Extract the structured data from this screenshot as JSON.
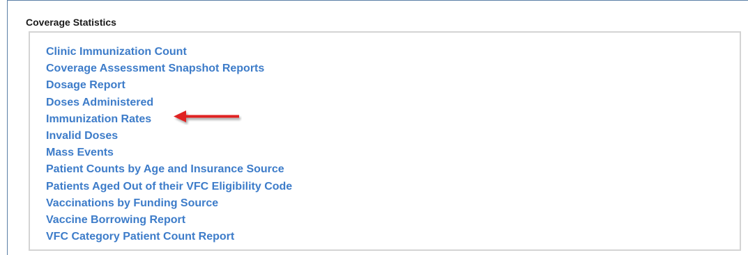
{
  "section": {
    "title": "Coverage Statistics"
  },
  "links": [
    {
      "label": "Clinic Immunization Count"
    },
    {
      "label": "Coverage Assessment Snapshot Reports"
    },
    {
      "label": "Dosage Report"
    },
    {
      "label": "Doses Administered"
    },
    {
      "label": "Immunization Rates",
      "highlighted": true
    },
    {
      "label": "Invalid Doses"
    },
    {
      "label": "Mass Events"
    },
    {
      "label": "Patient Counts by Age and Insurance Source"
    },
    {
      "label": "Patients Aged Out of their VFC Eligibility Code"
    },
    {
      "label": "Vaccinations by Funding Source"
    },
    {
      "label": "Vaccine Borrowing Report"
    },
    {
      "label": "VFC Category Patient Count Report"
    }
  ],
  "annotation": {
    "icon": "red-arrow-left-icon",
    "color": "#e02020"
  },
  "colors": {
    "link": "#3d7cc9",
    "frame_border": "#5b7fa6",
    "panel_border": "#d4d4d4"
  }
}
